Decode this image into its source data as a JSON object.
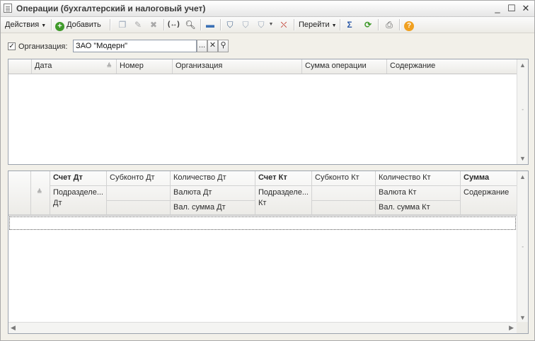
{
  "window": {
    "title": "Операции (бухгалтерский и налоговый учет)",
    "controls": {
      "minimize": "_",
      "maximize": "☐",
      "close": "✕"
    }
  },
  "toolbar": {
    "actions_label": "Действия",
    "add_label": "Добавить",
    "goto_label": "Перейти"
  },
  "filter": {
    "checked": true,
    "check_mark": "✓",
    "label": "Организация:",
    "value": "ЗАО \"Модерн\"",
    "select_button": "...",
    "clear_button": "✕",
    "search_button": "⚲"
  },
  "operations_table": {
    "columns": [
      "Дата",
      "Номер",
      "Организация",
      "Сумма операции",
      "Содержание"
    ],
    "rows": []
  },
  "entries_table": {
    "header_row1": [
      "Счет Дт",
      "Субконто Дт",
      "Количество Дт",
      "Счет Кт",
      "Субконто Кт",
      "Количество Кт",
      "Сумма"
    ],
    "header_row2": [
      "Подразделение Дт",
      "",
      "Валюта Дт",
      "Подразделение Кт",
      "",
      "Валюта Кт",
      "Содержание"
    ],
    "header_row3": [
      "",
      "",
      "Вал. сумма Дт",
      "",
      "",
      "Вал. сумма Кт",
      ""
    ],
    "header_row2_display": [
      "Подразделе... Дт",
      "Подразделе... Кт"
    ],
    "rows": []
  },
  "colors": {
    "accent_green": "#3f9a2a",
    "help_orange": "#f0a020",
    "grid_border": "#9ca3ad"
  },
  "icons": [
    "add-icon",
    "copy-icon",
    "edit-icon",
    "delete-icon",
    "balance-icon",
    "search-icon",
    "post-icon",
    "filter-icon",
    "filter-list-icon",
    "filter-clear-icon",
    "sum-icon",
    "refresh-icon",
    "print-icon",
    "help-icon"
  ]
}
